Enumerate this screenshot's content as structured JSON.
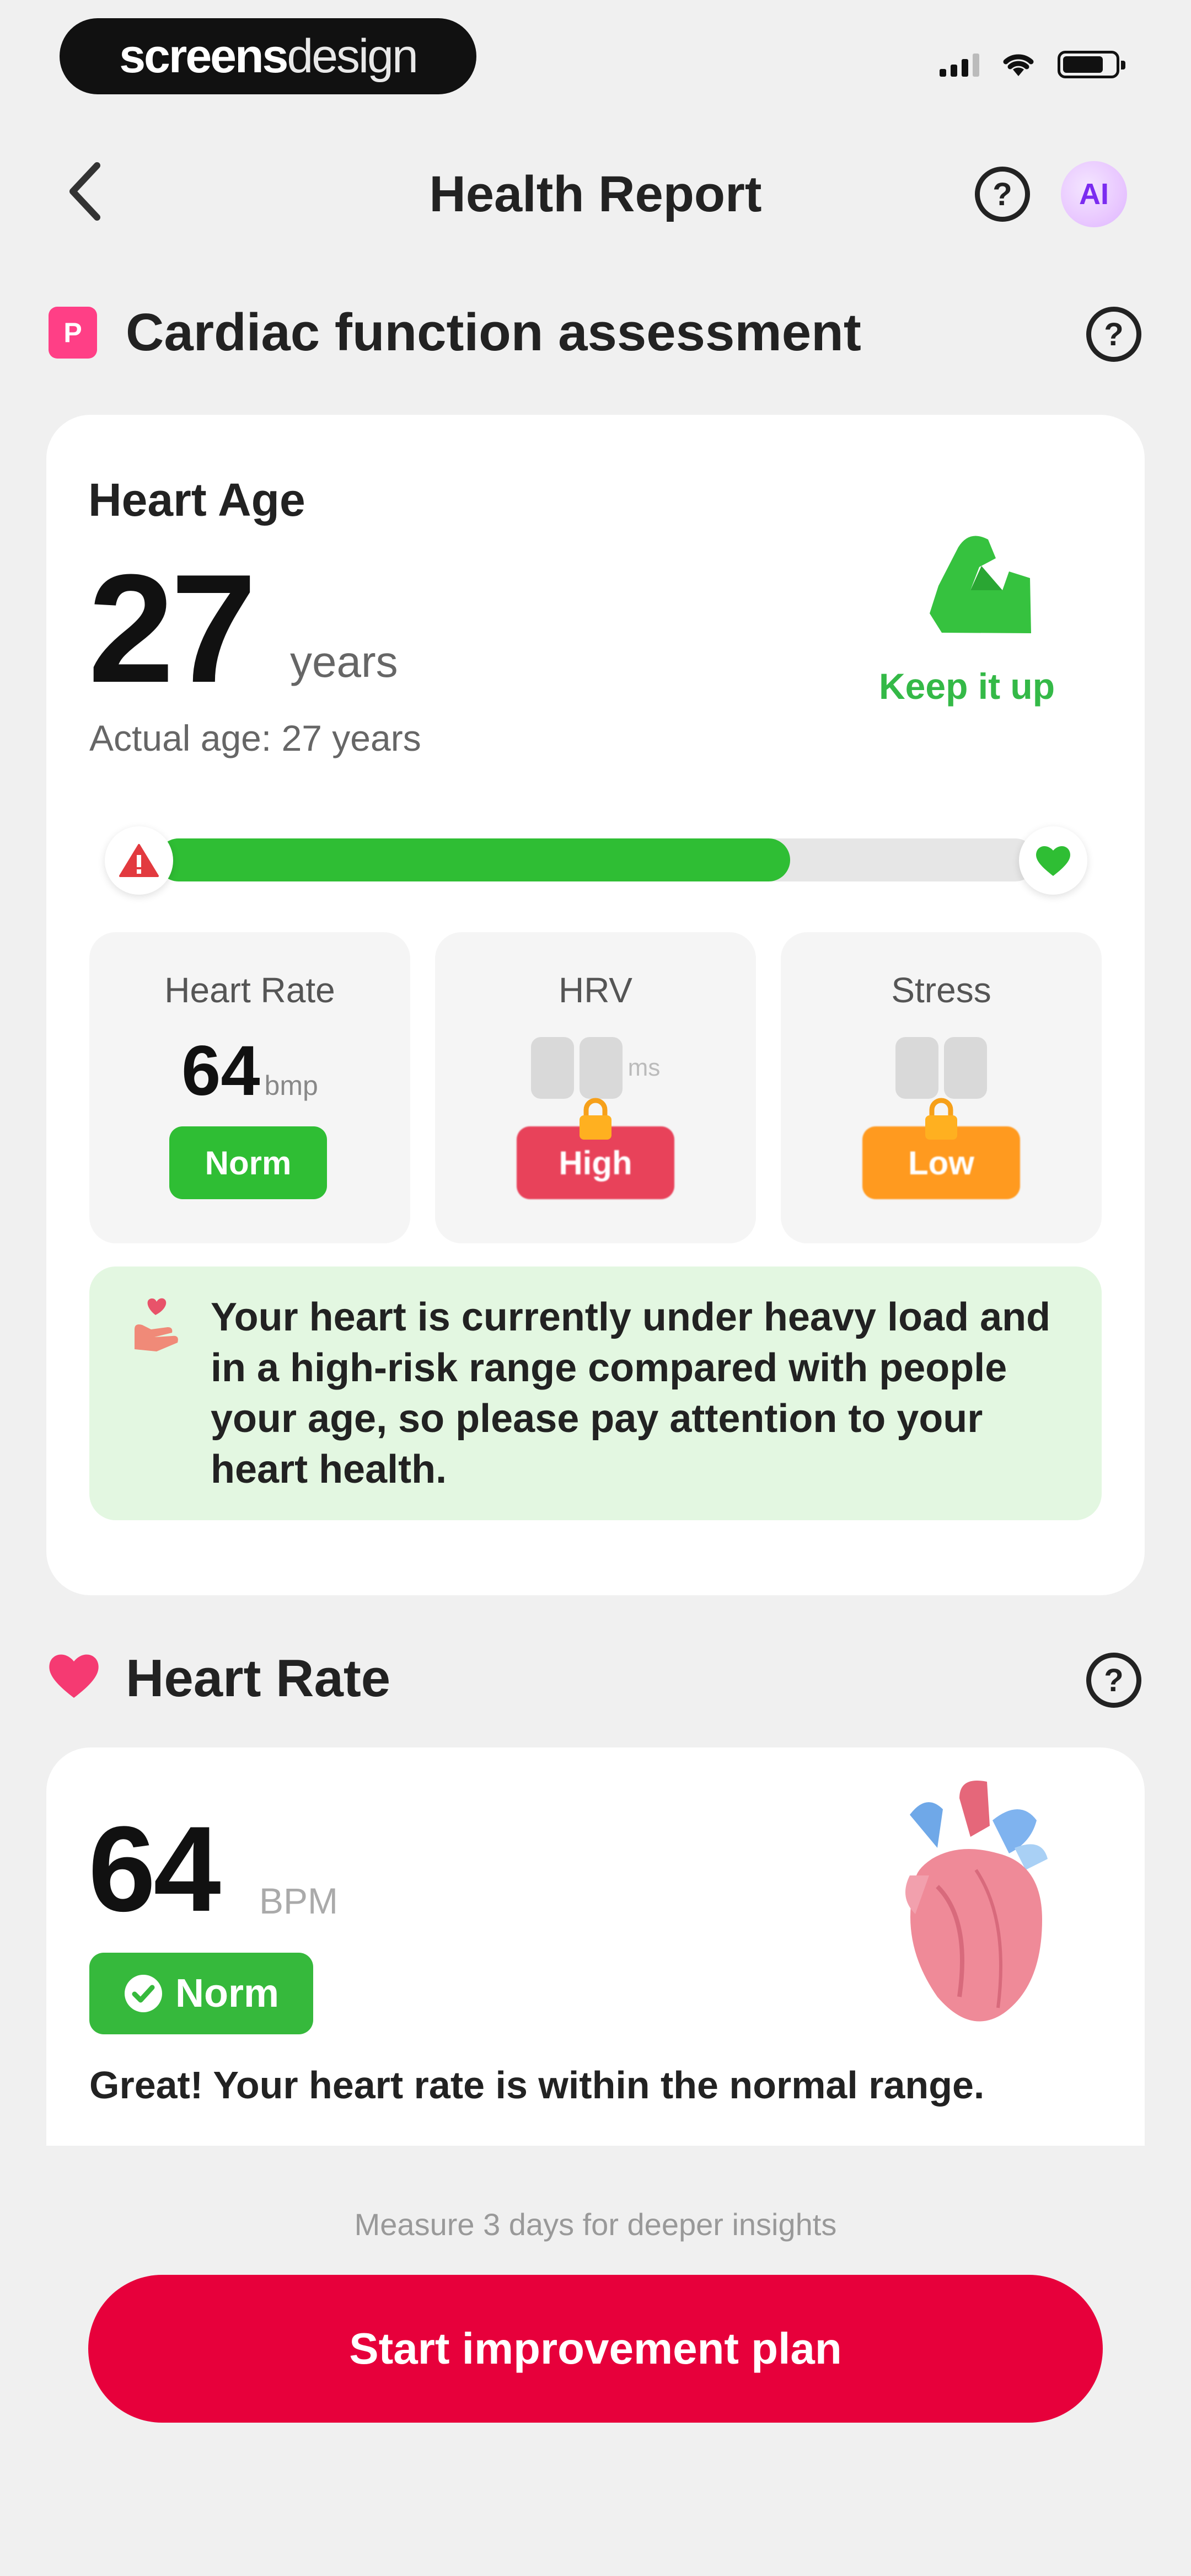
{
  "status_bar": {
    "brand_bold": "screens",
    "brand_light": "design",
    "signal_icon": "cellular-signal-icon",
    "wifi_icon": "wifi-icon",
    "battery_icon": "battery-icon"
  },
  "header": {
    "title": "Health Report",
    "back_icon": "chevron-left-icon",
    "help_icon": "question-circle-icon",
    "ai_label": "AI"
  },
  "cardiac": {
    "section_title": "Cardiac function assessment",
    "heart_age_label": "Heart Age",
    "heart_age_value": "27",
    "heart_age_unit": "years",
    "actual_age_text": "Actual age: 27 years",
    "keep_label": "Keep it up",
    "progress_fraction": 0.72,
    "metrics": [
      {
        "title": "Heart Rate",
        "value": "64",
        "unit": "bmp",
        "status": "Norm",
        "locked": false
      },
      {
        "title": "HRV",
        "value": "",
        "unit": "ms",
        "status": "High",
        "locked": true
      },
      {
        "title": "Stress",
        "value": "",
        "unit": "",
        "status": "Low",
        "locked": true
      }
    ],
    "alert_text": "Your heart is currently under heavy load and in a high-risk range compared with people your age, so please pay attention to your heart health."
  },
  "heart_rate": {
    "section_title": "Heart Rate",
    "value": "64",
    "unit": "BPM",
    "status": "Norm",
    "description": "Great! Your heart rate is within the normal range."
  },
  "footer": {
    "hint": "Measure 3 days for deeper insights",
    "cta_label": "Start improvement plan"
  },
  "colors": {
    "green": "#2fbe34",
    "red": "#e7003b",
    "pink": "#ff3f86",
    "orange": "#ff9a1f",
    "alert_bg": "#e3f7e1"
  }
}
